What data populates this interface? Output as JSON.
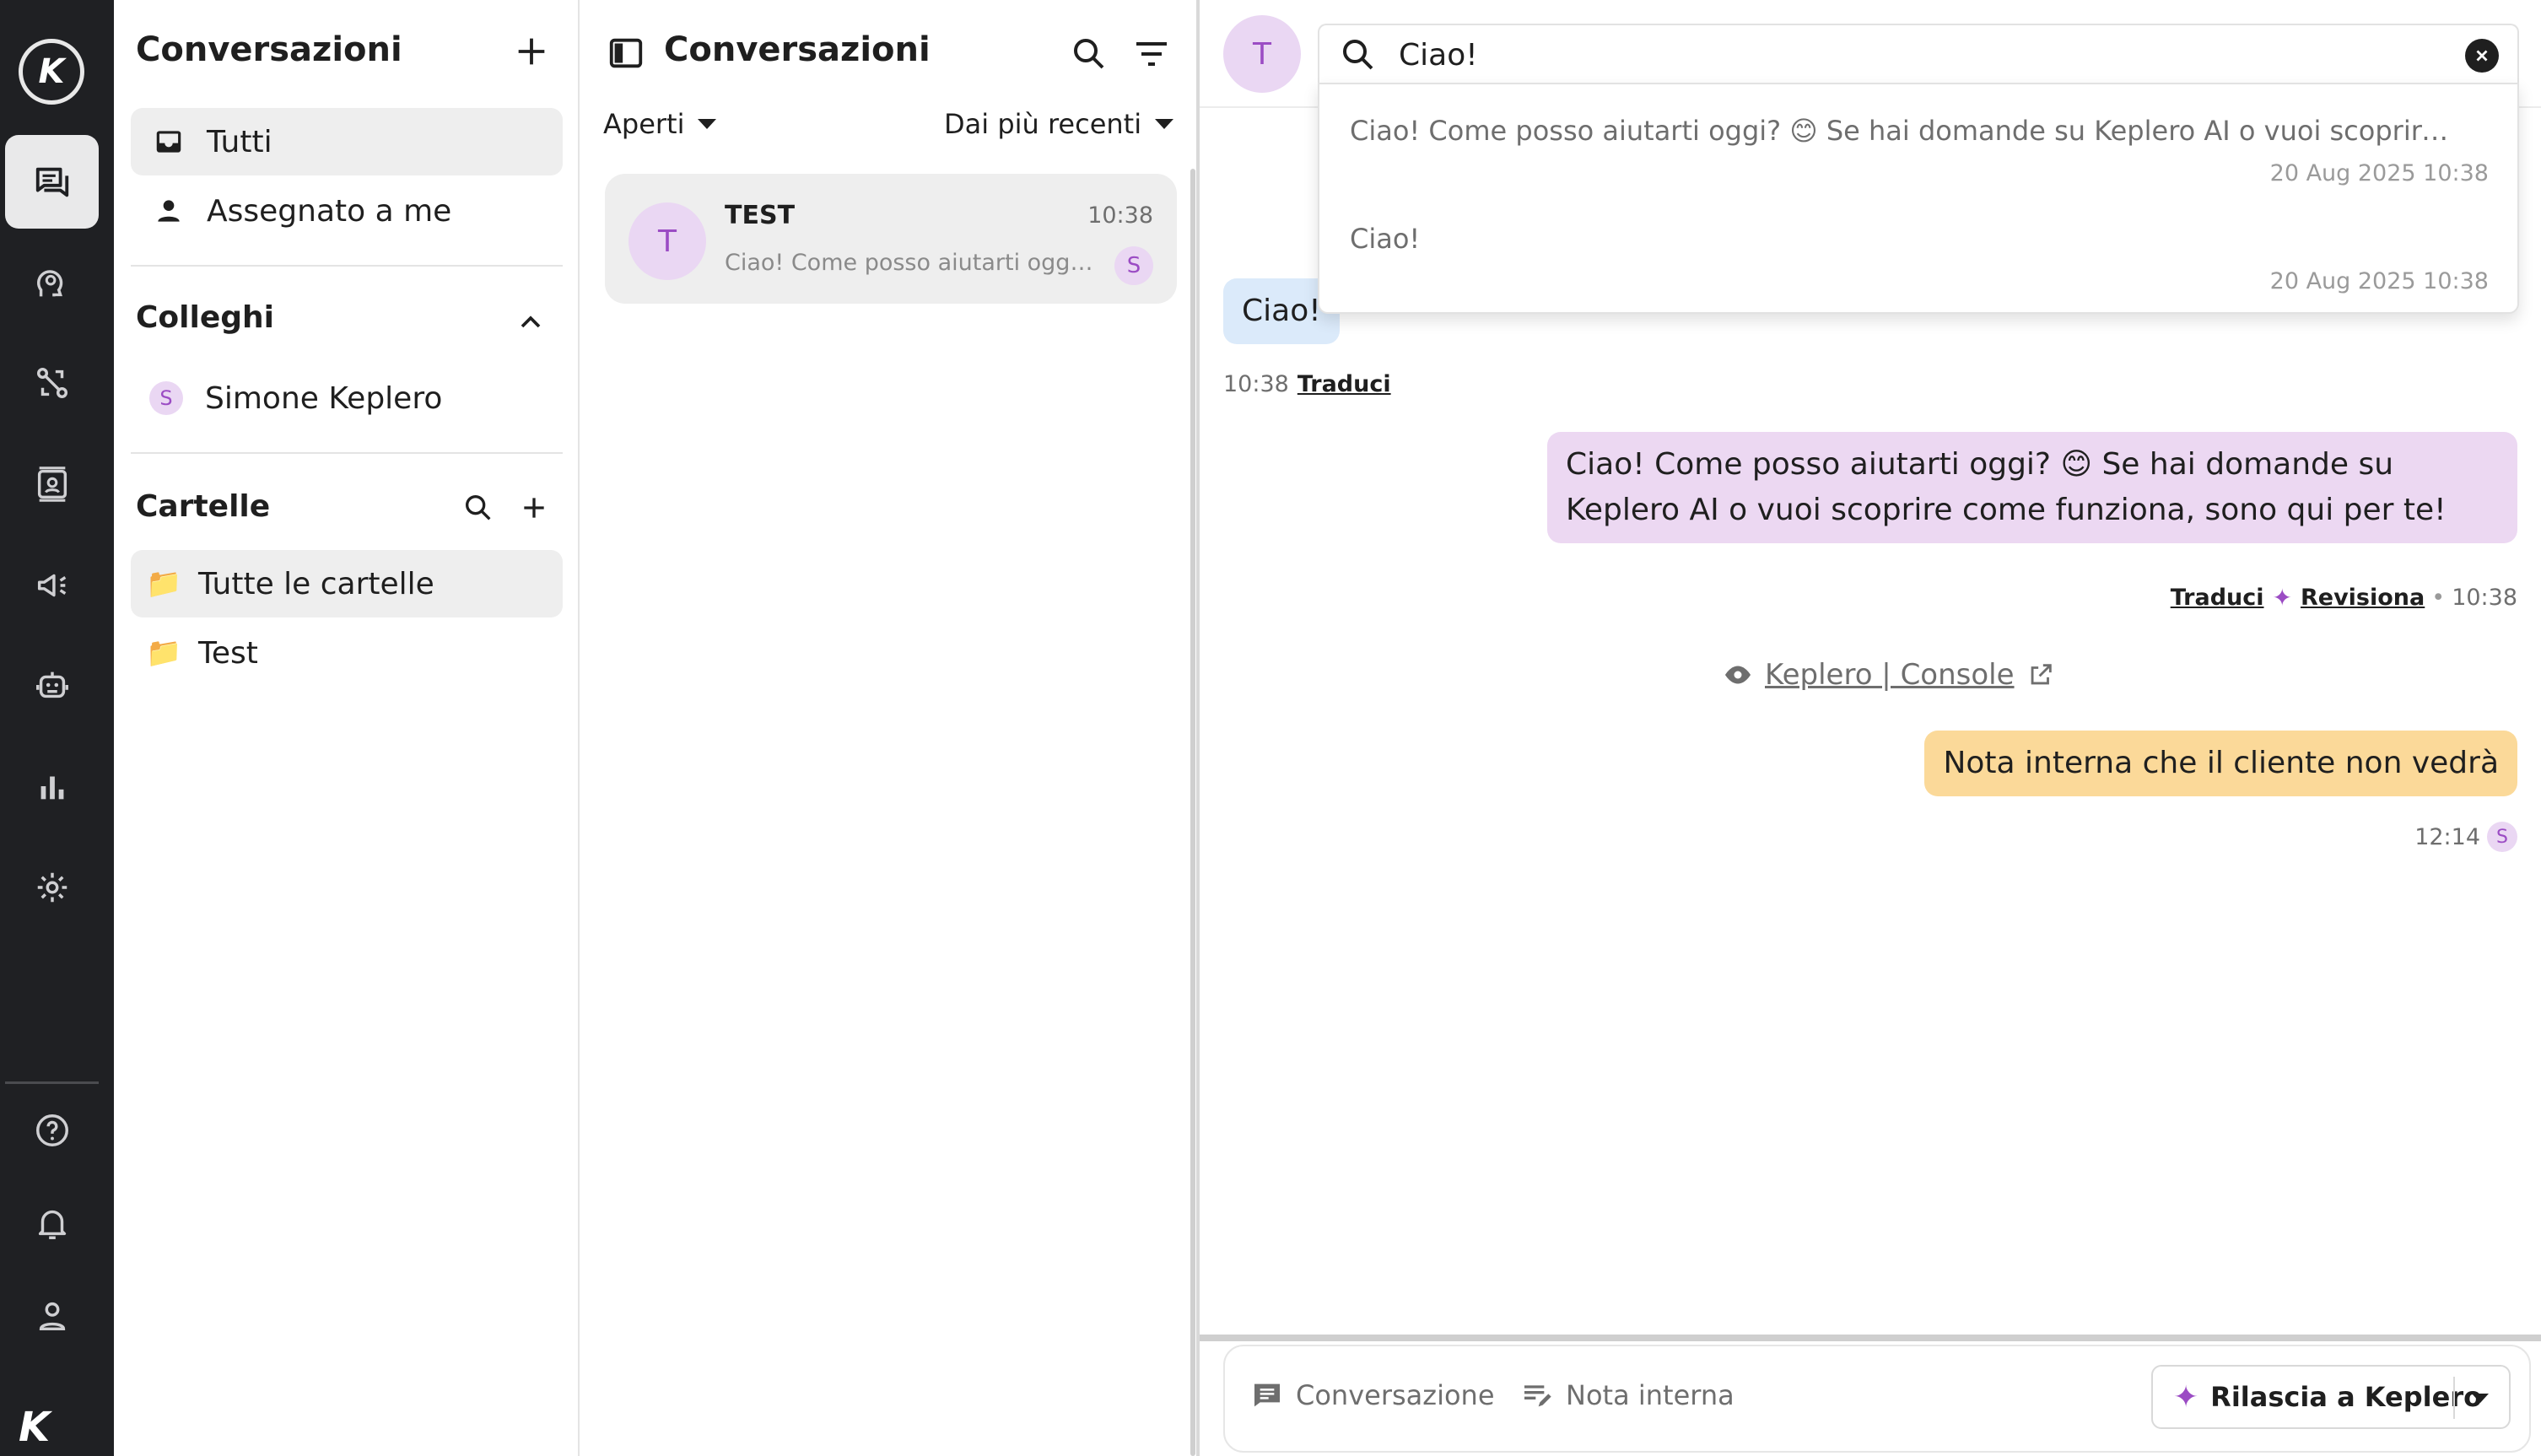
{
  "rail": {
    "logo": "K",
    "items": [
      {
        "name": "conversations",
        "icon": "chat-icon",
        "active": true
      },
      {
        "name": "knowledge",
        "icon": "head-gear-icon"
      },
      {
        "name": "workflows",
        "icon": "route-icon"
      },
      {
        "name": "contacts",
        "icon": "contact-card-icon"
      },
      {
        "name": "campaigns",
        "icon": "megaphone-icon"
      },
      {
        "name": "agents",
        "icon": "robot-icon"
      },
      {
        "name": "reports",
        "icon": "bar-chart-icon"
      },
      {
        "name": "settings",
        "icon": "gear-icon"
      },
      {
        "name": "help",
        "icon": "help-icon"
      },
      {
        "name": "notifications",
        "icon": "bell-icon"
      },
      {
        "name": "profile",
        "icon": "user-icon"
      }
    ]
  },
  "sidebar": {
    "title": "Conversazioni",
    "inbox": [
      {
        "label": "Tutti",
        "icon": "inbox-icon",
        "active": true
      },
      {
        "label": "Assegnato a me",
        "icon": "person-icon"
      }
    ],
    "colleagues_title": "Colleghi",
    "colleagues": [
      {
        "initial": "S",
        "label": "Simone Keplero"
      }
    ],
    "folders_title": "Cartelle",
    "folders": [
      {
        "label": "Tutte le cartelle",
        "active": true
      },
      {
        "label": "Test"
      }
    ]
  },
  "list": {
    "title": "Conversazioni",
    "status_filter": "Aperti",
    "sort": "Dai più recenti",
    "conversations": [
      {
        "initial": "T",
        "name": "TEST",
        "time": "10:38",
        "preview": "Ciao! Come posso aiutarti oggi? 😊 Se hai domande su Keplero AI o vuoi scoprire come funziona, sono qui per te!",
        "assignee": "S"
      }
    ]
  },
  "chat": {
    "avatar": "T",
    "search": {
      "value": "Ciao!",
      "results": [
        {
          "text": "Ciao! Come posso aiutarti oggi? 😊 Se hai domande su Keplero AI o vuoi scoprire come f...",
          "date": "20 Aug 2025 10:38"
        },
        {
          "text": "Ciao!",
          "date": "20 Aug 2025 10:38"
        }
      ]
    },
    "messages": {
      "incoming": {
        "text": "Ciao!",
        "time": "10:38",
        "translate": "Traduci"
      },
      "outgoing": {
        "text": "Ciao! Come posso aiutarti oggi? 😊 Se hai domande su Keplero AI o vuoi scoprire come funziona, sono qui per te!",
        "translate": "Traduci",
        "review": "Revisiona",
        "time": "10:38"
      },
      "source": "Keplero | Console",
      "note": {
        "text": "Nota interna che il cliente non vedrà",
        "time": "12:14",
        "author": "S"
      }
    },
    "composer": {
      "tab_conversation": "Conversazione",
      "tab_note": "Nota interna",
      "release_button": "Rilascia a Keplero"
    }
  },
  "colors": {
    "rail_bg": "#1f2023",
    "accent": "#9b4cc4",
    "avatar_bg": "#ead7f3",
    "incoming_bubble": "#dbeafa",
    "outgoing_bubble": "#ecd8f2",
    "note_bubble": "#fbd999"
  }
}
